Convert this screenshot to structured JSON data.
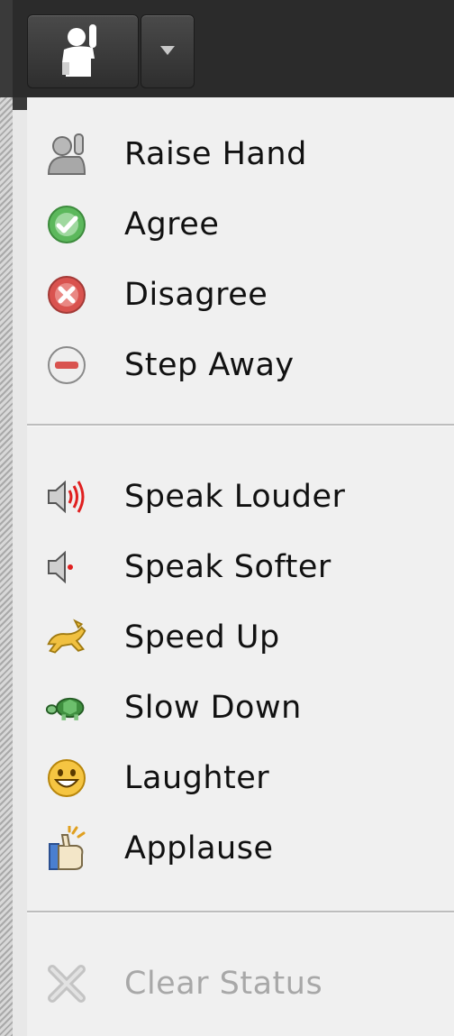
{
  "toolbar": {
    "status_button_icon": "raised-hand-person-icon",
    "dropdown_icon": "triangle-down-icon"
  },
  "menu": {
    "group_1": [
      {
        "label": "Raise Hand",
        "icon": "raise-hand-icon"
      },
      {
        "label": "Agree",
        "icon": "green-check-icon"
      },
      {
        "label": "Disagree",
        "icon": "red-x-icon"
      },
      {
        "label": "Step Away",
        "icon": "minus-circle-icon"
      }
    ],
    "group_2": [
      {
        "label": "Speak Louder",
        "icon": "speaker-loud-icon"
      },
      {
        "label": "Speak Softer",
        "icon": "speaker-soft-icon"
      },
      {
        "label": "Speed Up",
        "icon": "rabbit-icon"
      },
      {
        "label": "Slow Down",
        "icon": "turtle-icon"
      },
      {
        "label": "Laughter",
        "icon": "smiley-icon"
      },
      {
        "label": "Applause",
        "icon": "clapping-hands-icon"
      }
    ],
    "group_3": [
      {
        "label": "Clear Status",
        "icon": "grey-x-icon",
        "disabled": true
      }
    ]
  },
  "colors": {
    "toolbar_bg": "#2b2b2b",
    "menu_bg": "#f0f0f0",
    "text": "#111111",
    "disabled_text": "#a8a8a8",
    "agree_green": "#4caf50",
    "disagree_red": "#d9534f"
  }
}
